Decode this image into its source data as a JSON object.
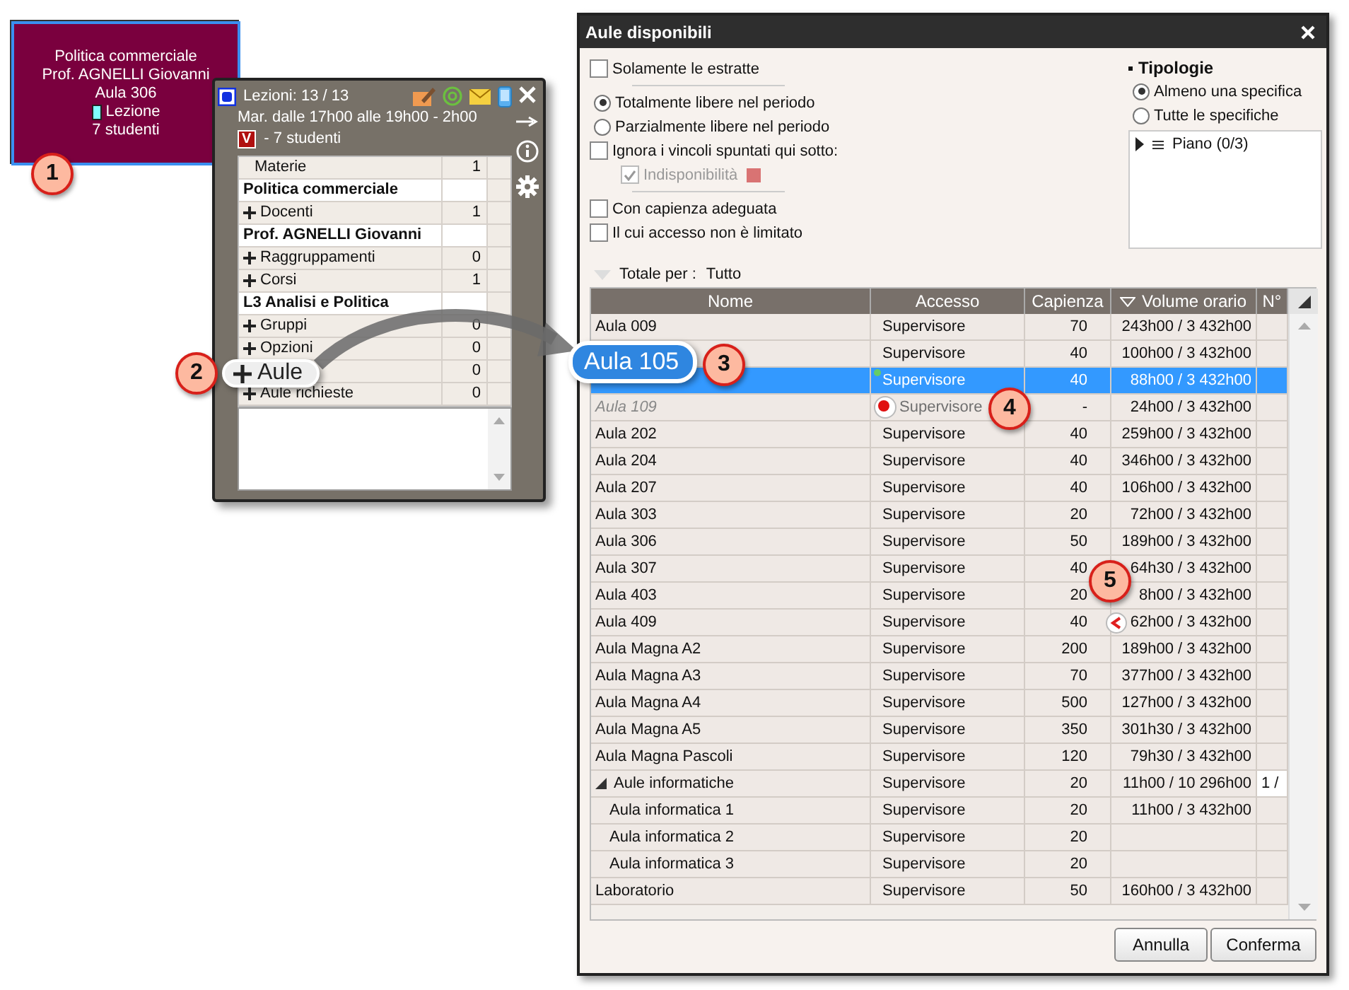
{
  "event_card": {
    "subject": "Politica commerciale",
    "teacher": "Prof. AGNELLI Giovanni",
    "room": "Aula 306",
    "type": "Lezione",
    "students": "7 studenti"
  },
  "popup": {
    "title": "Lezioni: 13 / 13",
    "schedule": "Mar. dalle 17h00 alle 19h00 - 2h00",
    "badge": "V",
    "students": "- 7 studenti",
    "rows": [
      {
        "kind": "item",
        "expandable": false,
        "label": "Materie",
        "value": "1"
      },
      {
        "kind": "heading",
        "label": "Politica commerciale"
      },
      {
        "kind": "item",
        "expandable": true,
        "label": "Docenti",
        "value": "1"
      },
      {
        "kind": "heading",
        "label": "Prof. AGNELLI Giovanni"
      },
      {
        "kind": "item",
        "expandable": true,
        "label": "Raggruppamenti",
        "value": "0"
      },
      {
        "kind": "item",
        "expandable": true,
        "label": "Corsi",
        "value": "1"
      },
      {
        "kind": "heading",
        "label": "L3 Analisi e Politica"
      },
      {
        "kind": "item",
        "expandable": true,
        "label": "Gruppi",
        "value": "0"
      },
      {
        "kind": "item",
        "expandable": true,
        "label": "Opzioni",
        "value": "0"
      },
      {
        "kind": "item",
        "value": "0"
      },
      {
        "kind": "item",
        "expandable": true,
        "label": "Aule richieste",
        "value": "0"
      }
    ]
  },
  "zoom_labels": {
    "room_field": "Aule",
    "room_name": "Aula 105"
  },
  "callouts": [
    "1",
    "2",
    "3",
    "4",
    "5"
  ],
  "dialog": {
    "title": "Aule disponibili",
    "filters": [
      {
        "kind": "checkbox",
        "label": "Solamente le estratte",
        "checked": false,
        "disabled": false,
        "rule_after": true
      },
      {
        "kind": "radio",
        "label": "Totalmente libere nel periodo",
        "selected": true,
        "disabled": false,
        "rule_after": false
      },
      {
        "kind": "radio",
        "label": "Parzialmente libere nel periodo",
        "selected": false,
        "disabled": false,
        "rule_after": false
      },
      {
        "kind": "checkbox",
        "label": "Ignora i vincoli spuntati qui sotto:",
        "checked": false,
        "disabled": false,
        "rule_after": false
      },
      {
        "kind": "sub-checkbox",
        "label": "Indisponibilità",
        "checked": true,
        "disabled": true,
        "color": "#d97373",
        "rule_after": true
      },
      {
        "kind": "checkbox",
        "label": "Con capienza adeguata",
        "checked": false,
        "disabled": false,
        "rule_after": false
      },
      {
        "kind": "checkbox",
        "label": "Il cui accesso non è limitato",
        "checked": false,
        "disabled": false,
        "rule_after": false
      }
    ],
    "typologies": {
      "title": "Tipologie",
      "options": [
        {
          "label": "Almeno una specifica",
          "selected": true
        },
        {
          "label": "Tutte le specifiche",
          "selected": false
        }
      ],
      "tree": [
        {
          "label": "Piano (0/3)",
          "expanded": false
        }
      ]
    },
    "total_by": {
      "label": "Totale per :",
      "value": "Tutto"
    },
    "table": {
      "columns": [
        {
          "label": "Nome",
          "sorted": false
        },
        {
          "label": "Accesso",
          "sorted": false
        },
        {
          "label": "Capienza",
          "sorted": false
        },
        {
          "label": "Volume orario",
          "sorted": true
        },
        {
          "label": "N°",
          "sorted": false
        }
      ],
      "rows": [
        {
          "kind": "room",
          "name": "Aula 009",
          "access": "Supervisore",
          "capacity": "70",
          "volume": "243h00 / 3 432h00",
          "selected": false,
          "available": true
        },
        {
          "kind": "room",
          "access": "Supervisore",
          "capacity": "40",
          "volume": "100h00 / 3 432h00",
          "selected": false,
          "available": true
        },
        {
          "kind": "free",
          "access": "Supervisore",
          "capacity": "40",
          "volume": "88h00 / 3 432h00",
          "selected": true,
          "available": true
        },
        {
          "kind": "blocked",
          "name": "Aula 109",
          "access": "Supervisore",
          "capacity": "-",
          "volume": "24h00 / 3 432h00",
          "selected": false,
          "available": false
        },
        {
          "kind": "room",
          "name": "Aula 202",
          "access": "Supervisore",
          "capacity": "40",
          "volume": "259h00 / 3 432h00",
          "selected": false,
          "available": true
        },
        {
          "kind": "room",
          "name": "Aula 204",
          "access": "Supervisore",
          "capacity": "40",
          "volume": "346h00 / 3 432h00",
          "selected": false,
          "available": true
        },
        {
          "kind": "room",
          "name": "Aula 207",
          "access": "Supervisore",
          "capacity": "40",
          "volume": "106h00 / 3 432h00",
          "selected": false,
          "available": true
        },
        {
          "kind": "room",
          "name": "Aula 303",
          "access": "Supervisore",
          "capacity": "20",
          "volume": "72h00 / 3 432h00",
          "selected": false,
          "available": true
        },
        {
          "kind": "room",
          "name": "Aula 306",
          "access": "Supervisore",
          "capacity": "50",
          "volume": "189h00 / 3 432h00",
          "selected": false,
          "available": true
        },
        {
          "kind": "room",
          "name": "Aula 307",
          "access": "Supervisore",
          "capacity": "40",
          "volume": "64h30 / 3 432h00",
          "selected": false,
          "available": true
        },
        {
          "kind": "room",
          "name": "Aula 403",
          "access": "Supervisore",
          "capacity": "20",
          "volume": "8h00 / 3 432h00",
          "selected": false,
          "available": true
        },
        {
          "kind": "capacity",
          "name": "Aula 409",
          "access": "Supervisore",
          "capacity": "40",
          "volume": "62h00 / 3 432h00",
          "selected": false,
          "available": true
        },
        {
          "kind": "room",
          "name": "Aula Magna  A2",
          "access": "Supervisore",
          "capacity": "200",
          "volume": "189h00 / 3 432h00",
          "selected": false,
          "available": true
        },
        {
          "kind": "room",
          "name": "Aula Magna  A3",
          "access": "Supervisore",
          "capacity": "70",
          "volume": "377h00 / 3 432h00",
          "selected": false,
          "available": true
        },
        {
          "kind": "room",
          "name": "Aula Magna  A4",
          "access": "Supervisore",
          "capacity": "500",
          "volume": "127h00 / 3 432h00",
          "selected": false,
          "available": true
        },
        {
          "kind": "room",
          "name": "Aula Magna  A5",
          "access": "Supervisore",
          "capacity": "350",
          "volume": "301h30 / 3 432h00",
          "selected": false,
          "available": true
        },
        {
          "kind": "room",
          "name": "Aula Magna Pascoli",
          "access": "Supervisore",
          "capacity": "120",
          "volume": "79h30 / 3 432h00",
          "selected": false,
          "available": true
        },
        {
          "kind": "group",
          "name": "Aule informatiche",
          "access": "Supervisore",
          "capacity": "20",
          "volume": "11h00 / 10 296h00",
          "number": "1 /",
          "selected": false,
          "available": true,
          "expanded": true,
          "children": [
            {
              "kind": "room",
              "name": "Aula informatica 1",
              "access": "Supervisore",
              "capacity": "20",
              "volume": "11h00 / 3 432h00",
              "selected": false,
              "available": true
            },
            {
              "kind": "room",
              "name": "Aula informatica 2",
              "access": "Supervisore",
              "capacity": "20",
              "selected": false,
              "available": true
            },
            {
              "kind": "room",
              "name": "Aula informatica 3",
              "access": "Supervisore",
              "capacity": "20",
              "selected": false,
              "available": true
            }
          ]
        },
        {
          "kind": "room",
          "name": "Laboratorio",
          "access": "Supervisore",
          "capacity": "50",
          "volume": "160h00 / 3 432h00",
          "selected": false,
          "available": true
        }
      ]
    },
    "buttons": [
      "Annulla",
      "Conferma"
    ]
  }
}
